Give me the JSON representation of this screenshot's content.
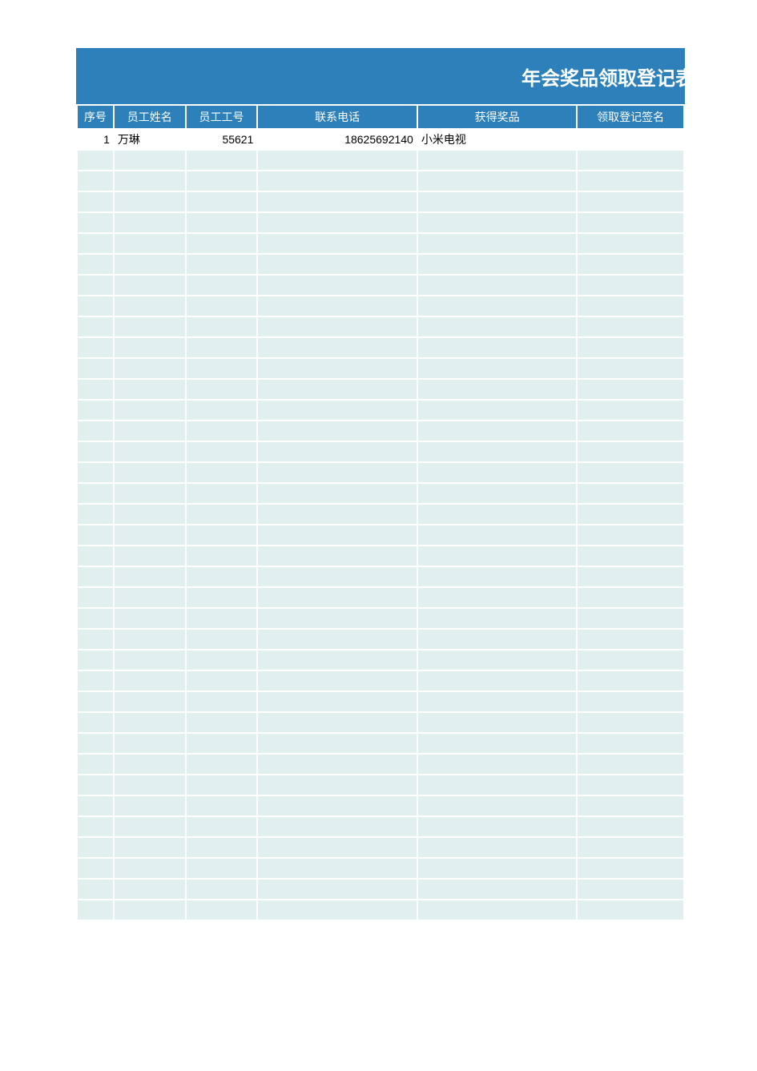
{
  "title": "年会奖品领取登记表",
  "columns": {
    "seq": "序号",
    "name": "员工姓名",
    "empid": "员工工号",
    "phone": "联系电话",
    "prize": "获得奖品",
    "sign": "领取登记签名"
  },
  "rows": [
    {
      "seq": "1",
      "name": "万琳",
      "empid": "55621",
      "phone": "18625692140",
      "prize": "小米电视",
      "sign": ""
    }
  ],
  "empty_row_count": 37
}
